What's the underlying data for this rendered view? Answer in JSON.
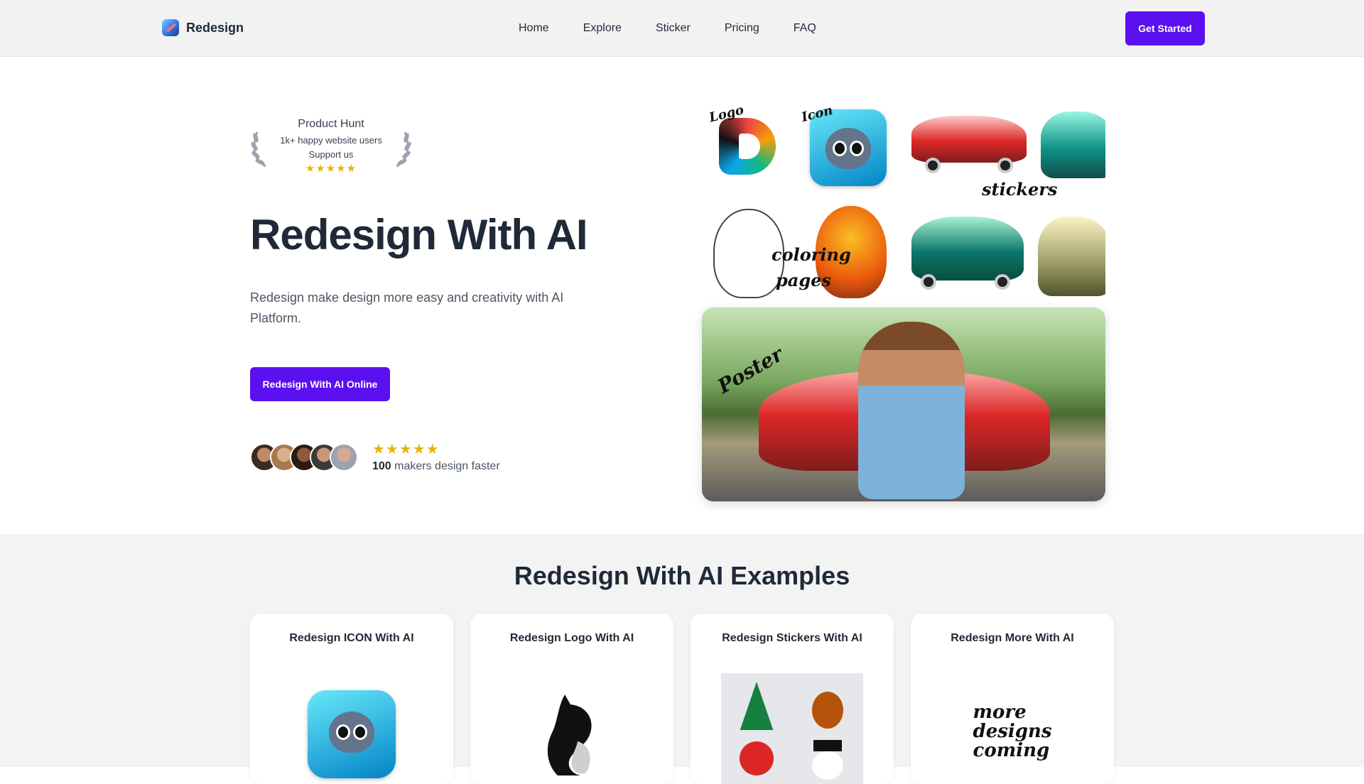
{
  "nav": {
    "brand": "Redesign",
    "links": [
      "Home",
      "Explore",
      "Sticker",
      "Pricing",
      "FAQ"
    ],
    "cta": "Get Started"
  },
  "hero": {
    "badge": {
      "title": "Product Hunt",
      "subtitle": "1k+ happy website users",
      "support": "Support us",
      "stars": "★★★★★",
      "rating": 5
    },
    "title": "Redesign With AI",
    "description": "Redesign make design more easy and creativity with AI Platform.",
    "cta": "Redesign With AI Online",
    "makers": {
      "stars": "★★★★★",
      "rating": 5,
      "count": "100",
      "text": " makers design faster"
    }
  },
  "showcase": {
    "labels": {
      "logo": "Logo",
      "icon": "Icon",
      "stickers": "stickers",
      "coloring": "coloring",
      "pages": "pages",
      "poster": "Poster"
    }
  },
  "examples": {
    "title": "Redesign With AI Examples",
    "cards": [
      {
        "title": "Redesign ICON With AI"
      },
      {
        "title": "Redesign Logo With AI"
      },
      {
        "title": "Redesign Stickers With AI"
      },
      {
        "title": "Redesign More With AI",
        "art_lines": [
          "more",
          "designs",
          "coming"
        ]
      }
    ]
  },
  "colors": {
    "accent": "#5b10f0",
    "star": "#eab308",
    "heading": "#1f2937",
    "nav_bg": "#f2f2f2",
    "section_bg": "#f3f3f3"
  }
}
